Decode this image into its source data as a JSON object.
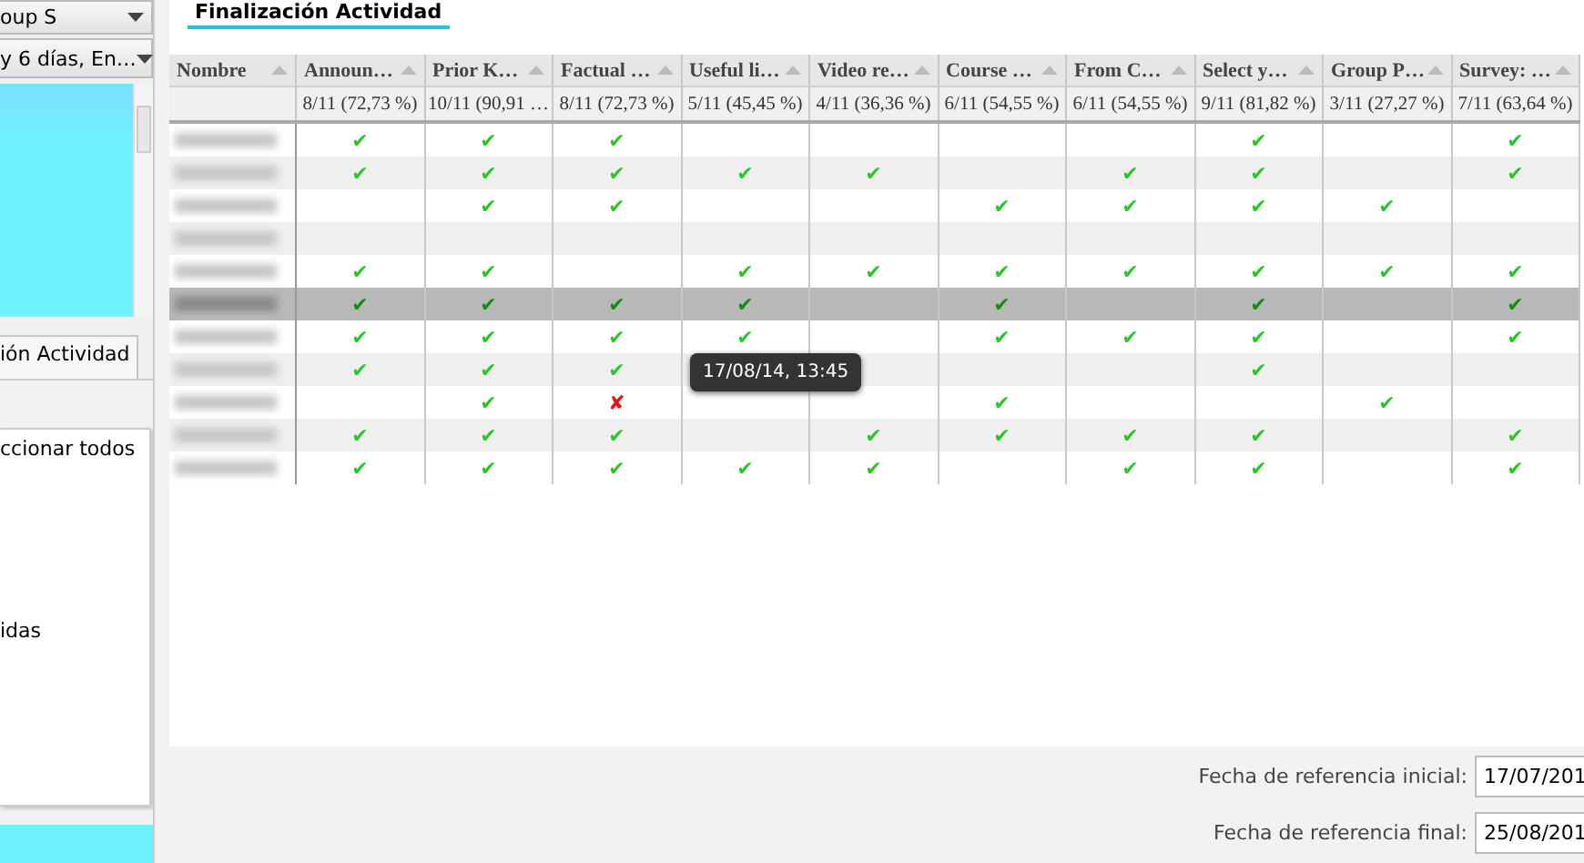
{
  "sidebar": {
    "combos": [
      {
        "value": "oup S"
      },
      {
        "value": "y 6 días, En…"
      }
    ],
    "tab": {
      "label": "ión Actividad",
      "selected": true
    },
    "popup": {
      "items": [
        "ccionar todos",
        "idas"
      ]
    }
  },
  "main_tab": {
    "label": "Finalización Actividad",
    "selected": true
  },
  "table": {
    "name_column": {
      "label": "Nombre"
    },
    "columns": [
      {
        "label": "Announ…",
        "summary": "8/11 (72,73 %)"
      },
      {
        "label": "Prior K…",
        "summary": "10/11 (90,91 …"
      },
      {
        "label": "Factual …",
        "summary": "8/11 (72,73 %)"
      },
      {
        "label": "Useful li…",
        "summary": "5/11 (45,45 %)"
      },
      {
        "label": "Video re…",
        "summary": "4/11 (36,36 %)"
      },
      {
        "label": "Course …",
        "summary": "6/11 (54,55 %)"
      },
      {
        "label": "From C…",
        "summary": "6/11 (54,55 %)"
      },
      {
        "label": "Select y…",
        "summary": "9/11 (81,82 %)"
      },
      {
        "label": "Group P…",
        "summary": "3/11 (27,27 %)"
      },
      {
        "label": "Survey: …",
        "summary": "7/11 (63,64 %)"
      }
    ],
    "rows": [
      {
        "selected": false,
        "cells": [
          "✔",
          "✔",
          "✔",
          null,
          null,
          null,
          null,
          "✔",
          null,
          "✔"
        ]
      },
      {
        "selected": false,
        "cells": [
          "✔",
          "✔",
          "✔",
          "✔",
          "✔",
          null,
          "✔",
          "✔",
          null,
          "✔"
        ]
      },
      {
        "selected": false,
        "cells": [
          null,
          "✔",
          "✔",
          null,
          null,
          "✔",
          "✔",
          "✔",
          "✔",
          null
        ]
      },
      {
        "selected": false,
        "cells": [
          null,
          null,
          null,
          null,
          null,
          null,
          null,
          null,
          null,
          null
        ]
      },
      {
        "selected": false,
        "cells": [
          "✔",
          "✔",
          null,
          "✔",
          "✔",
          "✔",
          "✔",
          "✔",
          "✔",
          "✔"
        ]
      },
      {
        "selected": true,
        "cells": [
          "✔",
          "✔",
          "✔",
          "✔",
          null,
          "✔",
          null,
          "✔",
          null,
          "✔"
        ]
      },
      {
        "selected": false,
        "cells": [
          "✔",
          "✔",
          "✔",
          "✔",
          null,
          "✔",
          "✔",
          "✔",
          null,
          "✔"
        ]
      },
      {
        "selected": false,
        "cells": [
          "✔",
          "✔",
          "✔",
          null,
          null,
          null,
          null,
          "✔",
          null,
          null
        ]
      },
      {
        "selected": false,
        "cells": [
          null,
          "✔",
          "✘",
          null,
          null,
          "✔",
          null,
          null,
          "✔",
          null
        ]
      },
      {
        "selected": false,
        "cells": [
          "✔",
          "✔",
          "✔",
          null,
          "✔",
          "✔",
          "✔",
          "✔",
          null,
          "✔"
        ]
      },
      {
        "selected": false,
        "cells": [
          "✔",
          "✔",
          "✔",
          "✔",
          "✔",
          null,
          "✔",
          "✔",
          null,
          "✔"
        ]
      }
    ]
  },
  "tooltip": {
    "text": "17/08/14, 13:45"
  },
  "dates": [
    {
      "label": "Fecha de referencia inicial:",
      "value": "17/07/201"
    },
    {
      "label": "Fecha de referencia final:",
      "value": "25/08/201"
    }
  ]
}
